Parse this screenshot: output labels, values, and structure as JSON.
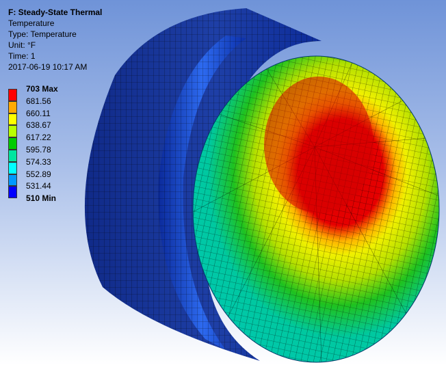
{
  "analysis": {
    "title": "F: Steady-State Thermal",
    "result": "Temperature",
    "type": "Type: Temperature",
    "unit": "Unit: °F",
    "time": "Time: 1",
    "timestamp": "2017-06-19 10:17 AM"
  },
  "legend": {
    "labels": [
      "703 Max",
      "681.56",
      "660.11",
      "638.67",
      "617.22",
      "595.78",
      "574.33",
      "552.89",
      "531.44",
      "510 Min"
    ],
    "colors": [
      "#ff0000",
      "#ffaa00",
      "#ffff00",
      "#b8ff00",
      "#00cc00",
      "#00e6a0",
      "#00ffff",
      "#0099ff",
      "#0000ff"
    ]
  },
  "colors": {
    "outer_shell": "#0a2a9a",
    "groove_band": "#1f4fd6",
    "cool_face": "#00c8a0",
    "warm_ring": "#e8e800",
    "hot_spot": "#d40000",
    "mesh_lines": "#000000"
  }
}
